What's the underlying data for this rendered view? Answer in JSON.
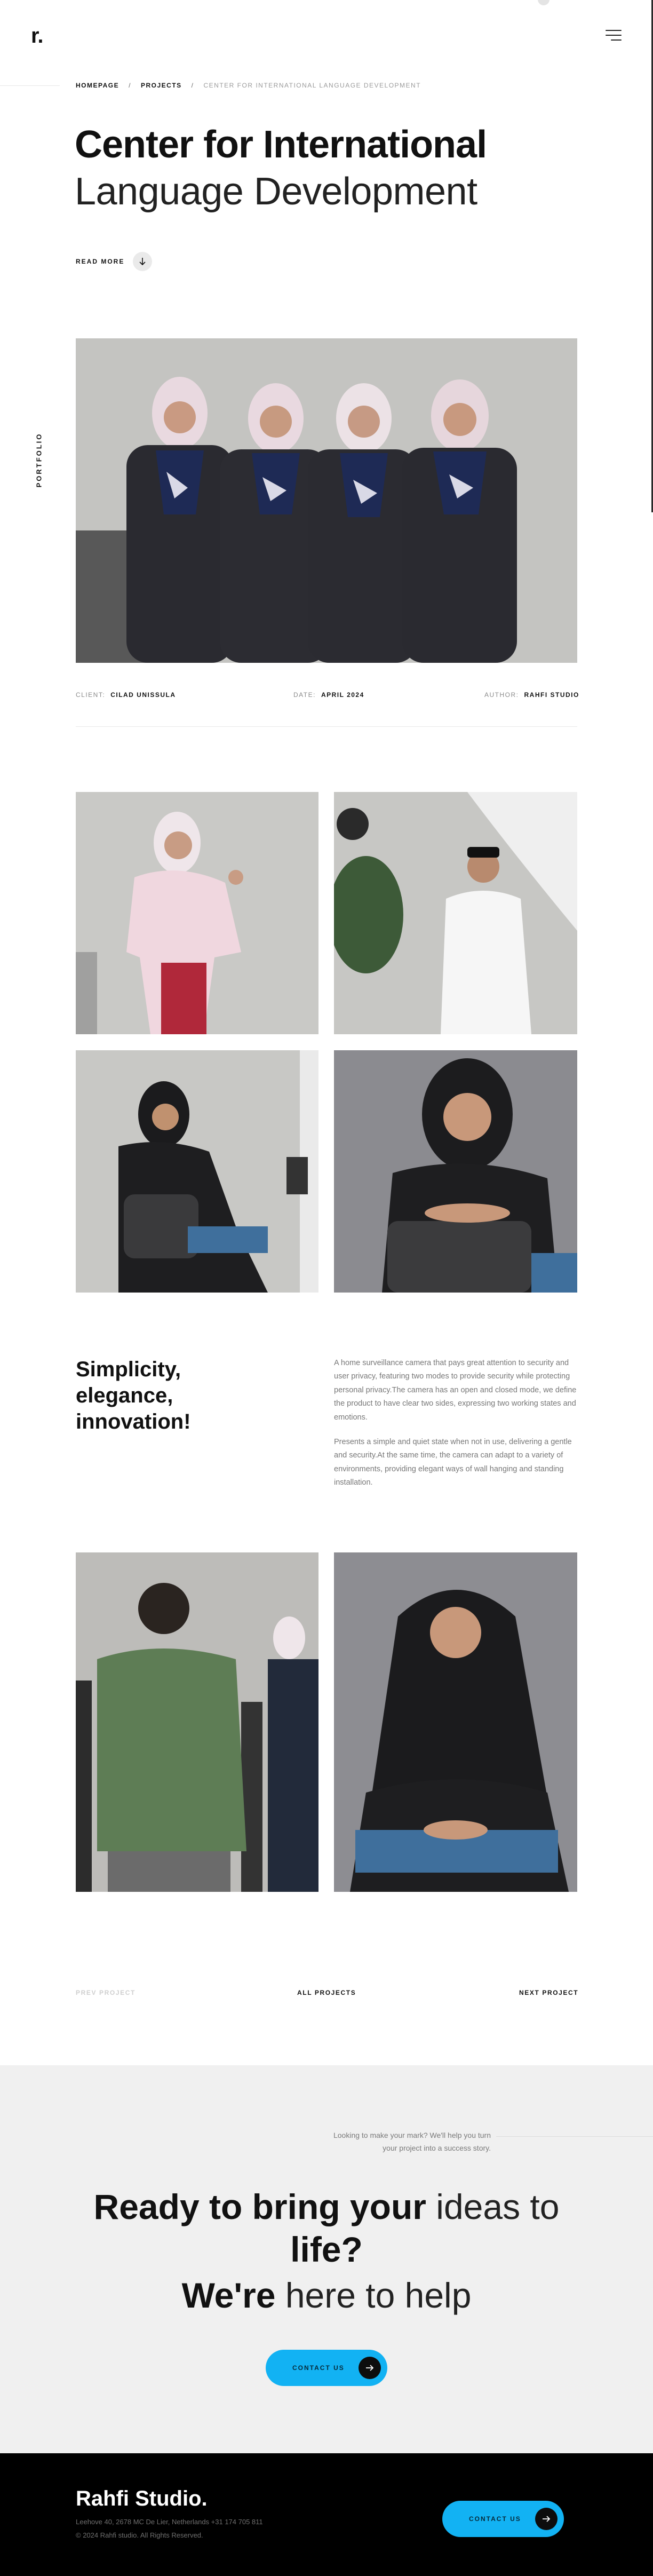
{
  "header": {
    "logo": "r.",
    "side_label": "PORTFOLIO"
  },
  "breadcrumb": {
    "home": "HOMEPAGE",
    "projects": "PROJECTS",
    "separator": "/",
    "current": "CENTER FOR INTERNATIONAL LANGUAGE DEVELOPMENT"
  },
  "hero": {
    "title_bold": "Center for International",
    "title_light": "Language Development",
    "read_more": "READ MORE"
  },
  "meta": {
    "client_key": "CLIENT:",
    "client_value": "CILAD UNISSULA",
    "date_key": "DATE:",
    "date_value": "APRIL 2024",
    "author_key": "AUTHOR:",
    "author_value": "RAHFI STUDIO"
  },
  "photos": [
    {
      "alt": "four-women-group-portrait"
    },
    {
      "alt": "woman-in-pink-hanbok"
    },
    {
      "alt": "man-in-white-shirt-arms-crossed"
    },
    {
      "alt": "woman-in-black-hijab-seated"
    },
    {
      "alt": "woman-smiling-leaning-on-chair"
    },
    {
      "alt": "man-in-green-shirt-back-view"
    },
    {
      "alt": "woman-in-black-hijab-sitting-smiling"
    }
  ],
  "content": {
    "tagline": "Simplicity, elegance, innovation!",
    "paragraph_1": "A home surveillance camera that pays great attention to security and user privacy, featuring two modes to provide security while protecting personal privacy.The camera has an open and closed mode, we define the product to have clear two sides, expressing two working states and emotions.",
    "paragraph_2": "Presents a simple and quiet state when not in use, delivering a gentle and security.At the same time, the camera can adapt to a variety of environments, providing elegant ways of wall hanging and standing installation."
  },
  "pagination": {
    "prev": "PREV PROJECT",
    "all": "ALL PROJECTS",
    "next": "NEXT PROJECT"
  },
  "cta": {
    "intro_line1": "Looking to make your mark? We'll help you turn",
    "intro_line2": "your project into a success story.",
    "head_bold_1": "Ready to bring your",
    "head_light_1": "ideas to",
    "head_bold_2": "life?",
    "head_bold_3": "We're",
    "head_light_3": "here to help",
    "button": "CONTACT US"
  },
  "footer": {
    "brand": "Rahfi Studio.",
    "address": "Leehove 40, 2678 MC De Lier, Netherlands +31 174 705 811",
    "copyright": "© 2024 Rahfi studio. All Rights Reserved.",
    "button": "CONTACT US"
  },
  "colors": {
    "accent": "#12b2f3",
    "cta_background": "#f0f0f0",
    "footer_background": "#000000"
  }
}
